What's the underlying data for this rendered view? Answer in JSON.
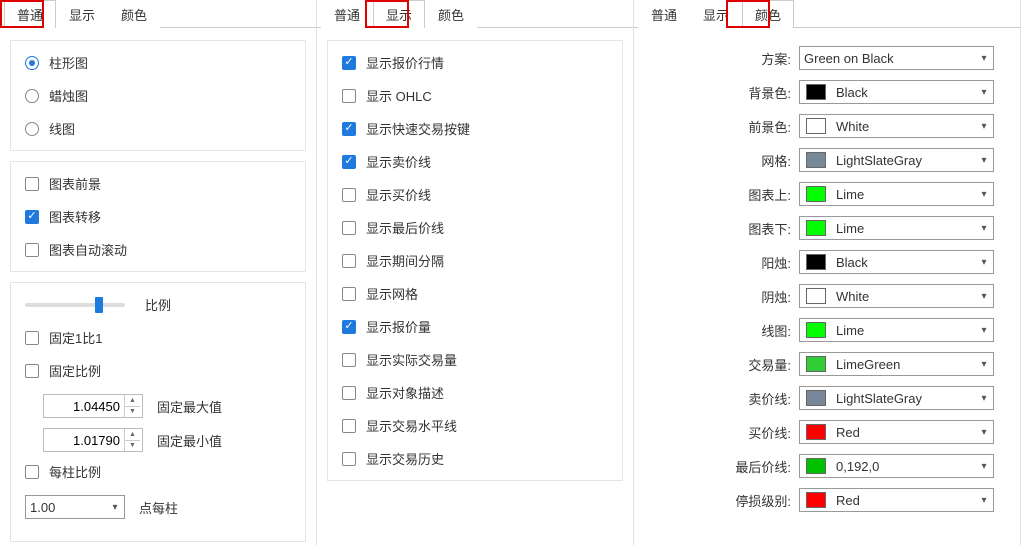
{
  "tabs": {
    "general": "普通",
    "display": "显示",
    "color": "颜色"
  },
  "panel1": {
    "chartTypes": {
      "bar": {
        "label": "柱形图",
        "checked": true
      },
      "candle": {
        "label": "蜡烛图",
        "checked": false
      },
      "line": {
        "label": "线图",
        "checked": false
      }
    },
    "viewOpts": {
      "fg": {
        "label": "图表前景",
        "checked": false
      },
      "shift": {
        "label": "图表转移",
        "checked": true
      },
      "auto": {
        "label": "图表自动滚动",
        "checked": false
      }
    },
    "scale": {
      "sliderLabel": "比例",
      "fix11": {
        "label": "固定1比1",
        "checked": false
      },
      "fixRatio": {
        "label": "固定比例",
        "checked": false
      },
      "maxVal": "1.04450",
      "maxLabel": "固定最大值",
      "minVal": "1.01790",
      "minLabel": "固定最小值",
      "perBar": {
        "label": "每柱比例",
        "checked": false
      },
      "points": "1.00",
      "pointsLabel": "点每柱"
    }
  },
  "panel2": {
    "items": [
      {
        "label": "显示报价行情",
        "checked": true
      },
      {
        "label": "显示 OHLC",
        "checked": false
      },
      {
        "label": "显示快速交易按键",
        "checked": true
      },
      {
        "label": "显示卖价线",
        "checked": true
      },
      {
        "label": "显示买价线",
        "checked": false
      },
      {
        "label": "显示最后价线",
        "checked": false
      },
      {
        "label": "显示期间分隔",
        "checked": false
      },
      {
        "label": "显示网格",
        "checked": false
      },
      {
        "label": "显示报价量",
        "checked": true
      },
      {
        "label": "显示实际交易量",
        "checked": false
      },
      {
        "label": "显示对象描述",
        "checked": false
      },
      {
        "label": "显示交易水平线",
        "checked": false
      },
      {
        "label": "显示交易历史",
        "checked": false
      }
    ]
  },
  "panel3": {
    "scheme": {
      "label": "方案:",
      "value": "Green on Black"
    },
    "colors": [
      {
        "label": "背景色:",
        "value": "Black",
        "swatch": "#000000"
      },
      {
        "label": "前景色:",
        "value": "White",
        "swatch": "#ffffff"
      },
      {
        "label": "网格:",
        "value": "LightSlateGray",
        "swatch": "#778899"
      },
      {
        "label": "图表上:",
        "value": "Lime",
        "swatch": "#00ff00"
      },
      {
        "label": "图表下:",
        "value": "Lime",
        "swatch": "#00ff00"
      },
      {
        "label": "阳烛:",
        "value": "Black",
        "swatch": "#000000"
      },
      {
        "label": "阴烛:",
        "value": "White",
        "swatch": "#ffffff"
      },
      {
        "label": "线图:",
        "value": "Lime",
        "swatch": "#00ff00"
      },
      {
        "label": "交易量:",
        "value": "LimeGreen",
        "swatch": "#32cd32"
      },
      {
        "label": "卖价线:",
        "value": "LightSlateGray",
        "swatch": "#778899"
      },
      {
        "label": "买价线:",
        "value": "Red",
        "swatch": "#ff0000"
      },
      {
        "label": "最后价线:",
        "value": "0,192,0",
        "swatch": "#00c000"
      },
      {
        "label": "停损级别:",
        "value": "Red",
        "swatch": "#ff0000"
      }
    ]
  }
}
